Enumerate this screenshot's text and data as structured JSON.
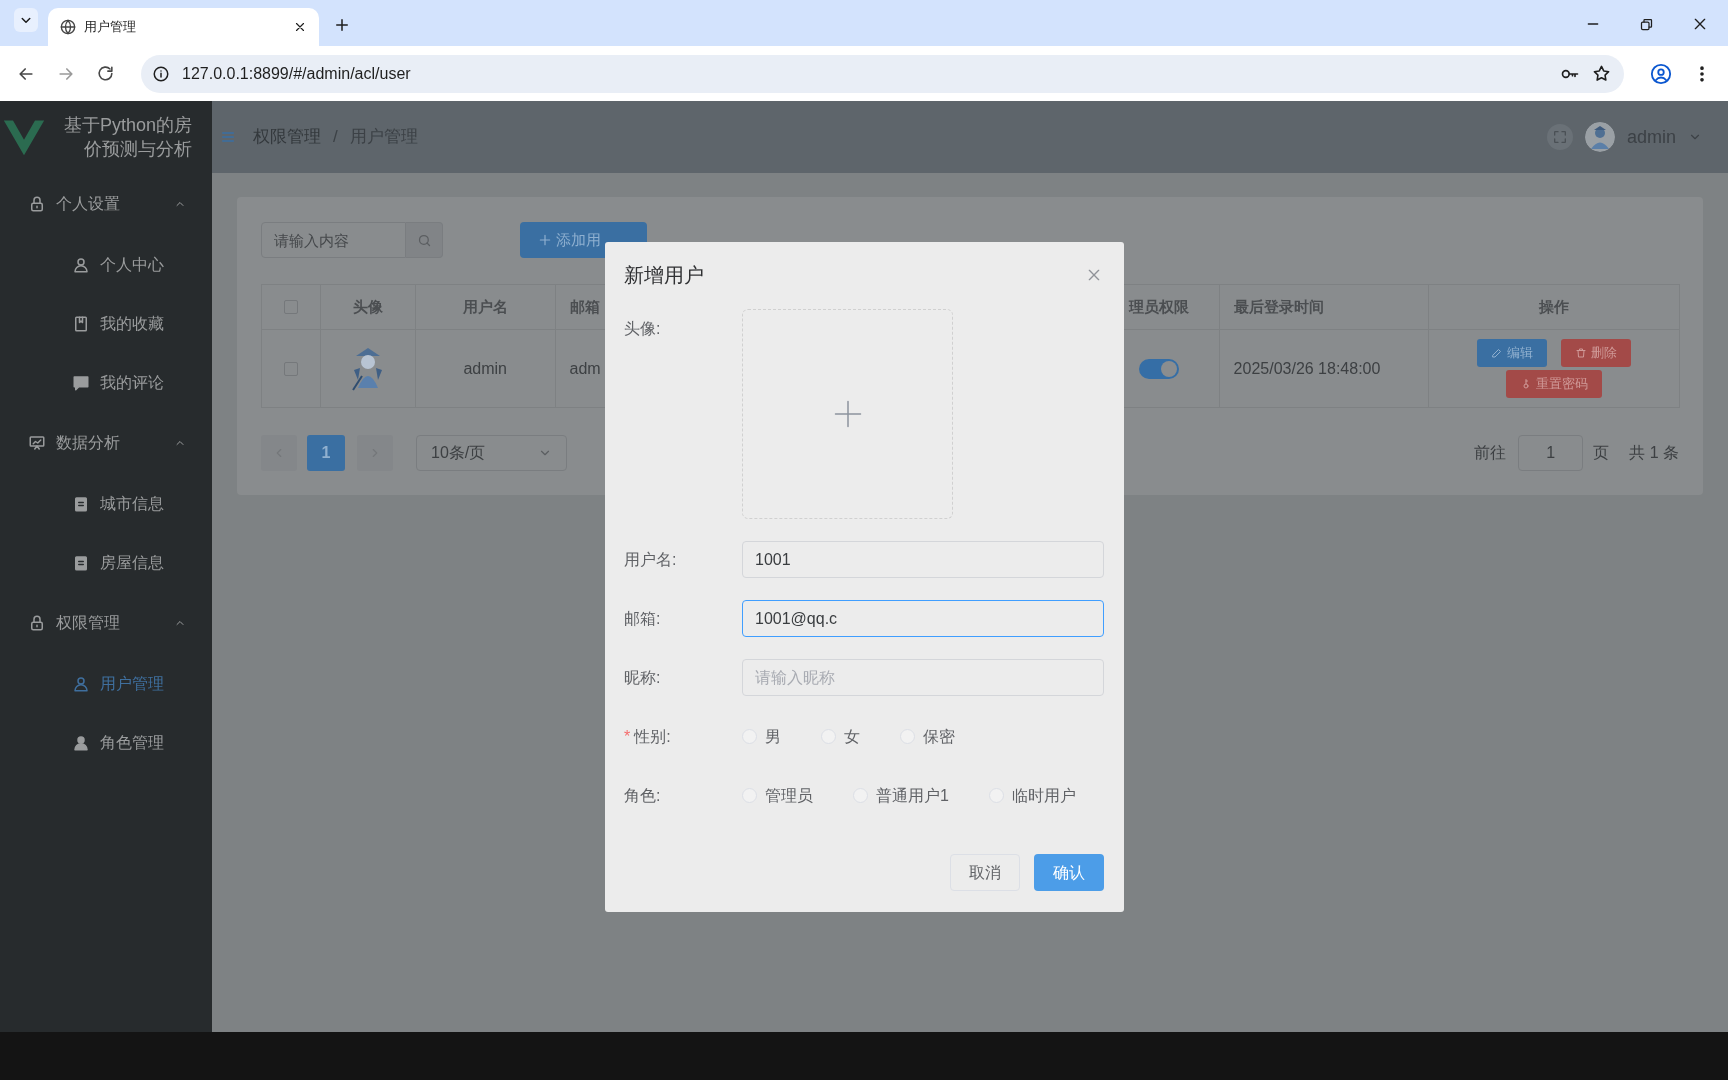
{
  "browser": {
    "tab_title": "用户管理",
    "url": "127.0.0.1:8899/#/admin/acl/user"
  },
  "app_title_lines": [
    "基于Python的房",
    "价预测与分析"
  ],
  "sidebar": {
    "groups": [
      {
        "label": "个人设置",
        "expanded": true,
        "children": [
          {
            "label": "个人中心",
            "selected": false
          },
          {
            "label": "我的收藏",
            "selected": false
          },
          {
            "label": "我的评论",
            "selected": false
          }
        ]
      },
      {
        "label": "数据分析",
        "expanded": true,
        "children": [
          {
            "label": "城市信息",
            "selected": false
          },
          {
            "label": "房屋信息",
            "selected": false
          }
        ]
      },
      {
        "label": "权限管理",
        "expanded": true,
        "children": [
          {
            "label": "用户管理",
            "selected": true
          },
          {
            "label": "角色管理",
            "selected": false
          }
        ]
      }
    ]
  },
  "header": {
    "breadcrumb": [
      "权限管理",
      "用户管理"
    ],
    "separator": "/",
    "user": "admin"
  },
  "toolbar": {
    "search": {
      "placeholder": "请输入内容"
    },
    "add_button": "添加用"
  },
  "table": {
    "select_all_checked": false,
    "columns": [
      {
        "label": "头像"
      },
      {
        "label": "用户名"
      },
      {
        "label": "邮箱"
      },
      {
        "label": "理员权限"
      },
      {
        "label": "最后登录时间"
      },
      {
        "label": "操作"
      }
    ],
    "rows": [
      {
        "checked": false,
        "username": "admin",
        "email": "adm",
        "admin_on": true,
        "last_login": "2025/03/26 18:48:00",
        "actions": [
          "编辑",
          "删除",
          "重置密码"
        ]
      }
    ]
  },
  "pagination": {
    "pages": [
      {
        "label": "1",
        "selected": true
      }
    ],
    "page_size": "10条/页",
    "goto_label": "前往",
    "goto_value": "1",
    "page_unit": "页",
    "total": "共 1 条"
  },
  "dialog": {
    "title": "新增用户",
    "required_mark": "*",
    "fields": [
      {
        "kind": "upload",
        "label": "头像:",
        "required": false
      },
      {
        "kind": "text",
        "label": "用户名:",
        "required": false,
        "value": "1001",
        "focused": false
      },
      {
        "kind": "text",
        "label": "邮箱:",
        "required": false,
        "value": "1001@qq.c",
        "focused": true
      },
      {
        "kind": "text",
        "label": "昵称:",
        "required": false,
        "placeholder": "请输入昵称",
        "focused": false
      },
      {
        "kind": "radio",
        "label": "性别:",
        "required": true,
        "options": [
          {
            "label": "男",
            "selected": false
          },
          {
            "label": "女",
            "selected": false
          },
          {
            "label": "保密",
            "selected": false
          }
        ]
      },
      {
        "kind": "radio",
        "label": "角色:",
        "required": false,
        "options": [
          {
            "label": "管理员",
            "selected": false
          },
          {
            "label": "普通用户1",
            "selected": false
          },
          {
            "label": "临时用户",
            "selected": false
          }
        ]
      }
    ],
    "cancel": "取消",
    "confirm": "确认"
  }
}
